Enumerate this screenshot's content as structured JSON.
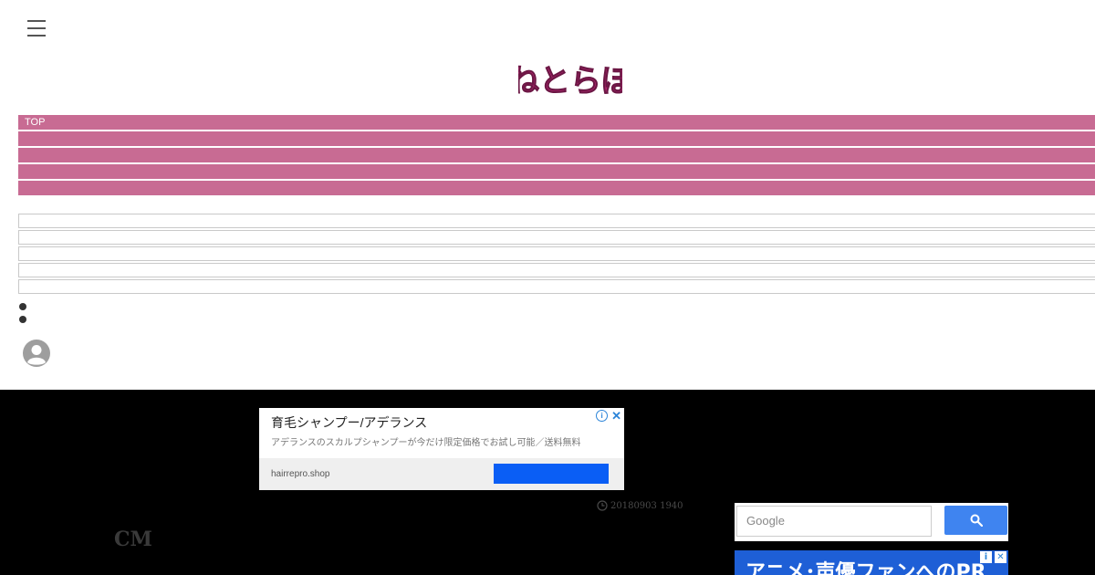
{
  "header": {
    "logo_text": "ねとらぼ"
  },
  "nav": {
    "items": [
      {
        "label": "TOP"
      },
      {
        "label": ""
      },
      {
        "label": ""
      },
      {
        "label": ""
      },
      {
        "label": ""
      }
    ]
  },
  "ad": {
    "title": "育毛シャンプー/アデランス",
    "description": "アデランスのスカルプシャンプーが今だけ限定価格でお試し可能／送料無料",
    "domain": "hairrepro.shop",
    "info_label": "i",
    "close_label": "✕"
  },
  "article": {
    "timestamp": "20180903 1940",
    "cm_label": "CM"
  },
  "search": {
    "placeholder": "Google"
  },
  "banner": {
    "text": "アニメ･声優ファンへのPR"
  },
  "colors": {
    "nav_pink": "#c86b93",
    "search_blue": "#3f84f0",
    "ad_cta_blue": "#0a5ef5"
  }
}
